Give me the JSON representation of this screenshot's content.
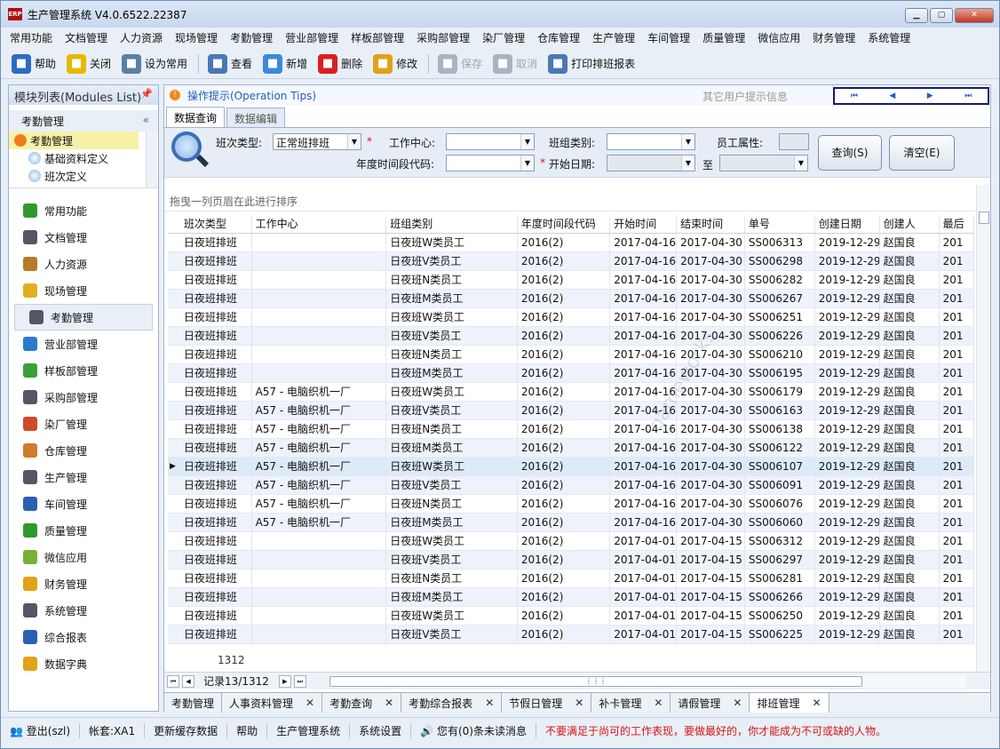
{
  "window": {
    "title": "生产管理系统 V4.0.6522.22387",
    "app_icon": "ERP",
    "buttons": [
      "minimize",
      "maximize",
      "close"
    ]
  },
  "menu": [
    "常用功能",
    "文档管理",
    "人力资源",
    "现场管理",
    "考勤管理",
    "营业部管理",
    "样板部管理",
    "采购部管理",
    "染厂管理",
    "仓库管理",
    "生产管理",
    "车间管理",
    "质量管理",
    "微信应用",
    "财务管理",
    "系统管理"
  ],
  "toolbar": [
    {
      "label": "帮助",
      "icon": "help-icon",
      "color": "#2b6cc4",
      "enabled": true
    },
    {
      "label": "关闭",
      "icon": "exit-icon",
      "color": "#e8b800",
      "enabled": true
    },
    {
      "label": "设为常用",
      "icon": "printer-icon",
      "color": "#5b7fa6",
      "enabled": true
    },
    {
      "label": "查看",
      "icon": "view-icon",
      "color": "#4a78b5",
      "enabled": true
    },
    {
      "label": "新增",
      "icon": "new-doc-icon",
      "color": "#3b8ad9",
      "enabled": true
    },
    {
      "label": "删除",
      "icon": "delete-icon",
      "color": "#d82020",
      "enabled": true
    },
    {
      "label": "修改",
      "icon": "edit-pencil-icon",
      "color": "#e0a21a",
      "enabled": true
    },
    {
      "label": "保存",
      "icon": "save-icon",
      "color": "#aab4c0",
      "enabled": false
    },
    {
      "label": "取消",
      "icon": "cancel-icon",
      "color": "#aab4c0",
      "enabled": false
    },
    {
      "label": "打印排班报表",
      "icon": "print-report-icon",
      "color": "#4a78b5",
      "enabled": true
    }
  ],
  "left": {
    "header": "模块列表(Modules List)",
    "sub": "考勤管理",
    "tree": [
      {
        "label": "考勤管理",
        "level": 0,
        "selected": true
      },
      {
        "label": "基础资料定义",
        "level": 1
      },
      {
        "label": "班次定义",
        "level": 1
      }
    ],
    "modules": [
      {
        "label": "常用功能",
        "icon": "apps-icon",
        "color": "#2e9a2e"
      },
      {
        "label": "文档管理",
        "icon": "document-icon",
        "color": "#556"
      },
      {
        "label": "人力资源",
        "icon": "people-icon",
        "color": "#b57a2a"
      },
      {
        "label": "现场管理",
        "icon": "crown-icon",
        "color": "#e0b020"
      },
      {
        "label": "考勤管理",
        "icon": "clock-icon",
        "color": "#556",
        "selected": true
      },
      {
        "label": "营业部管理",
        "icon": "globe-icon",
        "color": "#2a7ad0"
      },
      {
        "label": "样板部管理",
        "icon": "puzzle-icon",
        "color": "#3aa03a"
      },
      {
        "label": "采购部管理",
        "icon": "list-icon",
        "color": "#556"
      },
      {
        "label": "染厂管理",
        "icon": "pie-chart-icon",
        "color": "#d04a2a"
      },
      {
        "label": "仓库管理",
        "icon": "warehouse-icon",
        "color": "#d07a2a"
      },
      {
        "label": "生产管理",
        "icon": "wrench-icon",
        "color": "#556"
      },
      {
        "label": "车间管理",
        "icon": "org-chart-icon",
        "color": "#2a60b0"
      },
      {
        "label": "质量管理",
        "icon": "flag-icon",
        "color": "#2e9a2e"
      },
      {
        "label": "微信应用",
        "icon": "wechat-icon",
        "color": "#7ab03a"
      },
      {
        "label": "财务管理",
        "icon": "wallet-icon",
        "color": "#e0a21a"
      },
      {
        "label": "系统管理",
        "icon": "tools-icon",
        "color": "#556"
      },
      {
        "label": "综合报表",
        "icon": "bar-chart-icon",
        "color": "#2a60b0"
      },
      {
        "label": "数据字典",
        "icon": "dictionary-icon",
        "color": "#e0a21a"
      }
    ]
  },
  "main": {
    "tips": "操作提示(Operation Tips)",
    "other_tips": "其它用户提示信息",
    "pager_buttons": [
      "⏮",
      "◀",
      "▶",
      "⏭"
    ],
    "tabs": [
      {
        "label": "数据查询",
        "active": true
      },
      {
        "label": "数据编辑",
        "active": false
      }
    ],
    "filter": {
      "shift_type_label": "班次类型:",
      "shift_type_value": "正常班排班",
      "work_center_label": "工作中心:",
      "work_center_value": "",
      "group_type_label": "班组类别:",
      "group_type_value": "",
      "employee_attr_label": "员工属性:",
      "employee_attr_value": "",
      "period_code_label": "年度时间段代码:",
      "period_code_value": "",
      "start_date_label": "开始日期:",
      "start_date_value": "",
      "to_label": "至",
      "to_value": "",
      "query_button": "查询(S)",
      "clear_button": "清空(E)",
      "required_mark": "*"
    },
    "group_hint": "拖曳一列页眉在此进行排序",
    "columns": [
      "班次类型",
      "工作中心",
      "班组类别",
      "年度时间段代码",
      "开始时间",
      "结束时间",
      "单号",
      "创建日期",
      "创建人",
      "最后"
    ],
    "rows": [
      [
        "日夜班排班",
        "",
        "日夜班W类员工",
        "2016(2)",
        "2017-04-16",
        "2017-04-30",
        "SS006313",
        "2019-12-29",
        "赵国良",
        "201"
      ],
      [
        "日夜班排班",
        "",
        "日夜班V类员工",
        "2016(2)",
        "2017-04-16",
        "2017-04-30",
        "SS006298",
        "2019-12-29",
        "赵国良",
        "201"
      ],
      [
        "日夜班排班",
        "",
        "日夜班N类员工",
        "2016(2)",
        "2017-04-16",
        "2017-04-30",
        "SS006282",
        "2019-12-29",
        "赵国良",
        "201"
      ],
      [
        "日夜班排班",
        "",
        "日夜班M类员工",
        "2016(2)",
        "2017-04-16",
        "2017-04-30",
        "SS006267",
        "2019-12-29",
        "赵国良",
        "201"
      ],
      [
        "日夜班排班",
        "",
        "日夜班W类员工",
        "2016(2)",
        "2017-04-16",
        "2017-04-30",
        "SS006251",
        "2019-12-29",
        "赵国良",
        "201"
      ],
      [
        "日夜班排班",
        "",
        "日夜班V类员工",
        "2016(2)",
        "2017-04-16",
        "2017-04-30",
        "SS006226",
        "2019-12-29",
        "赵国良",
        "201"
      ],
      [
        "日夜班排班",
        "",
        "日夜班N类员工",
        "2016(2)",
        "2017-04-16",
        "2017-04-30",
        "SS006210",
        "2019-12-29",
        "赵国良",
        "201"
      ],
      [
        "日夜班排班",
        "",
        "日夜班M类员工",
        "2016(2)",
        "2017-04-16",
        "2017-04-30",
        "SS006195",
        "2019-12-29",
        "赵国良",
        "201"
      ],
      [
        "日夜班排班",
        "A57 - 电脑织机一厂",
        "日夜班W类员工",
        "2016(2)",
        "2017-04-16",
        "2017-04-30",
        "SS006179",
        "2019-12-29",
        "赵国良",
        "201"
      ],
      [
        "日夜班排班",
        "A57 - 电脑织机一厂",
        "日夜班V类员工",
        "2016(2)",
        "2017-04-16",
        "2017-04-30",
        "SS006163",
        "2019-12-29",
        "赵国良",
        "201"
      ],
      [
        "日夜班排班",
        "A57 - 电脑织机一厂",
        "日夜班N类员工",
        "2016(2)",
        "2017-04-16",
        "2017-04-30",
        "SS006138",
        "2019-12-29",
        "赵国良",
        "201"
      ],
      [
        "日夜班排班",
        "A57 - 电脑织机一厂",
        "日夜班M类员工",
        "2016(2)",
        "2017-04-16",
        "2017-04-30",
        "SS006122",
        "2019-12-29",
        "赵国良",
        "201"
      ],
      [
        "日夜班排班",
        "A57 - 电脑织机一厂",
        "日夜班W类员工",
        "2016(2)",
        "2017-04-16",
        "2017-04-30",
        "SS006107",
        "2019-12-29",
        "赵国良",
        "201"
      ],
      [
        "日夜班排班",
        "A57 - 电脑织机一厂",
        "日夜班V类员工",
        "2016(2)",
        "2017-04-16",
        "2017-04-30",
        "SS006091",
        "2019-12-29",
        "赵国良",
        "201"
      ],
      [
        "日夜班排班",
        "A57 - 电脑织机一厂",
        "日夜班N类员工",
        "2016(2)",
        "2017-04-16",
        "2017-04-30",
        "SS006076",
        "2019-12-29",
        "赵国良",
        "201"
      ],
      [
        "日夜班排班",
        "A57 - 电脑织机一厂",
        "日夜班M类员工",
        "2016(2)",
        "2017-04-16",
        "2017-04-30",
        "SS006060",
        "2019-12-29",
        "赵国良",
        "201"
      ],
      [
        "日夜班排班",
        "",
        "日夜班W类员工",
        "2016(2)",
        "2017-04-01",
        "2017-04-15",
        "SS006312",
        "2019-12-29",
        "赵国良",
        "201"
      ],
      [
        "日夜班排班",
        "",
        "日夜班V类员工",
        "2016(2)",
        "2017-04-01",
        "2017-04-15",
        "SS006297",
        "2019-12-29",
        "赵国良",
        "201"
      ],
      [
        "日夜班排班",
        "",
        "日夜班N类员工",
        "2016(2)",
        "2017-04-01",
        "2017-04-15",
        "SS006281",
        "2019-12-29",
        "赵国良",
        "201"
      ],
      [
        "日夜班排班",
        "",
        "日夜班M类员工",
        "2016(2)",
        "2017-04-01",
        "2017-04-15",
        "SS006266",
        "2019-12-29",
        "赵国良",
        "201"
      ],
      [
        "日夜班排班",
        "",
        "日夜班W类员工",
        "2016(2)",
        "2017-04-01",
        "2017-04-15",
        "SS006250",
        "2019-12-29",
        "赵国良",
        "201"
      ],
      [
        "日夜班排班",
        "",
        "日夜班V类员工",
        "2016(2)",
        "2017-04-01",
        "2017-04-15",
        "SS006225",
        "2019-12-29",
        "赵国良",
        "201"
      ]
    ],
    "current_row": 12,
    "count": "1312",
    "record_text": "记录13/1312",
    "bottom_tabs": [
      {
        "label": "考勤管理",
        "closable": false
      },
      {
        "label": "人事资料管理",
        "closable": true
      },
      {
        "label": "考勤查询",
        "closable": true
      },
      {
        "label": "考勤综合报表",
        "closable": true
      },
      {
        "label": "节假日管理",
        "closable": true
      },
      {
        "label": "补卡管理",
        "closable": true
      },
      {
        "label": "请假管理",
        "closable": true
      },
      {
        "label": "排班管理",
        "closable": true,
        "active": true
      }
    ]
  },
  "status": {
    "logout": "登出(szl)",
    "account": "帐套:XA1",
    "refresh": "更新缓存数据",
    "help": "帮助",
    "system": "生产管理系统",
    "settings": "系统设置",
    "messages": "您有(0)条未读消息",
    "motto": "不要满足于尚可的工作表现，要做最好的，你才能成为不可或缺的人物。"
  }
}
